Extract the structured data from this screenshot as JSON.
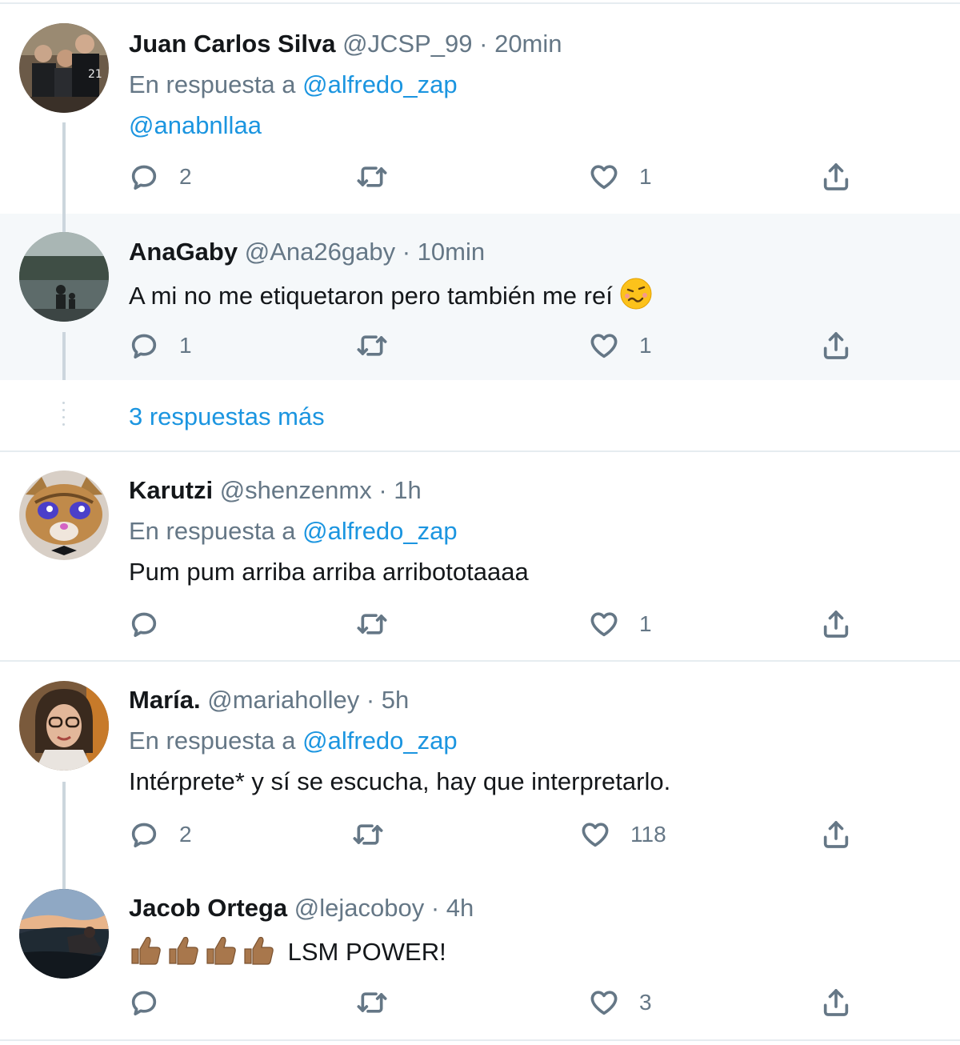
{
  "reply_prefix": "En respuesta a",
  "tweets": [
    {
      "name": "Juan Carlos Silva",
      "handle": "@JCSP_99",
      "time": "· 20min",
      "reply_to": "@alfredo_zap",
      "text": "@anabnllaa",
      "replies": "2",
      "likes": "1"
    },
    {
      "name": "AnaGaby",
      "handle": "@Ana26gaby",
      "time": "· 10min",
      "text": "A mi no me etiquetaron pero también me reí",
      "emoji": "woozy-face-emoji",
      "replies": "1",
      "likes": "1"
    },
    {
      "name": "Karutzi",
      "handle": "@shenzenmx",
      "time": "· 1h",
      "reply_to": "@alfredo_zap",
      "text": "Pum pum arriba arriba arribototaaaa",
      "replies": "",
      "likes": "1"
    },
    {
      "name": "María.",
      "handle": "@mariaholley",
      "time": "· 5h",
      "reply_to": "@alfredo_zap",
      "text": "Intérprete* y sí se escucha, hay que interpretarlo.",
      "replies": "2",
      "likes": "118"
    },
    {
      "name": "Jacob Ortega",
      "handle": "@lejacoboy",
      "time": "· 4h",
      "text": "LSM POWER!",
      "emoji": "thumbs-up-emoji",
      "replies": "",
      "likes": "3"
    }
  ],
  "more_replies": "3 respuestas más",
  "colors": {
    "link": "#1b95e0",
    "muted": "#657786",
    "highlight": "#f5f8fa",
    "divider": "#e6ecf0"
  }
}
